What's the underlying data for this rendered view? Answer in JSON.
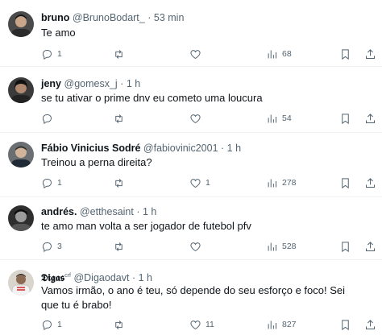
{
  "tweets": [
    {
      "name": "bruno",
      "handle": "@BrunoBodart_",
      "sep": "·",
      "time": "53 min",
      "text": "Te amo",
      "replies": "1",
      "retweets": "",
      "likes": "",
      "views": "68"
    },
    {
      "name": "jeny",
      "handle": "@gomesx_j",
      "sep": "·",
      "time": "1 h",
      "text": "se tu ativar o prime dnv eu cometo uma loucura",
      "replies": "",
      "retweets": "",
      "likes": "",
      "views": "54"
    },
    {
      "name": "Fábio Vinicius Sodré",
      "handle": "@fabiovinic2001",
      "sep": "·",
      "time": "1 h",
      "text": "Treinou a perna direita?",
      "replies": "1",
      "retweets": "",
      "likes": "1",
      "views": "278"
    },
    {
      "name": "andrés.",
      "handle": "@etthesaint",
      "sep": "·",
      "time": "1 h",
      "text": "te amo man volta a ser jogador de futebol pfv",
      "replies": "3",
      "retweets": "",
      "likes": "",
      "views": "528"
    },
    {
      "name": "𝕯𝖎𝖌𝖆𝖘",
      "name_sup": "crf",
      "handle": "@Digaodavt",
      "sep": "·",
      "time": "1 h",
      "text": "Vamos irmão, o ano é teu, só depende do seu esforço e foco! Sei que tu é brabo!",
      "replies": "1",
      "retweets": "",
      "likes": "11",
      "views": "827"
    }
  ],
  "icons": {
    "reply": "reply-icon",
    "retweet": "retweet-icon",
    "like": "heart-icon",
    "views": "views-icon",
    "bookmark": "bookmark-icon",
    "share": "share-icon"
  },
  "colors": {
    "text": "#0f1419",
    "secondary": "#536471",
    "divider": "#eff3f4"
  }
}
